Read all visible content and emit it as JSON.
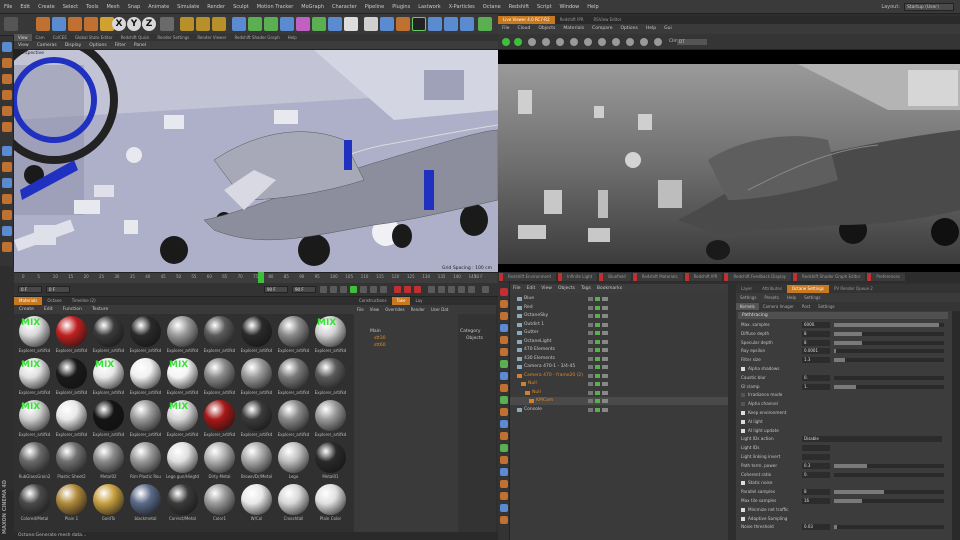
{
  "menubar": {
    "items": [
      "File",
      "Edit",
      "Create",
      "Select",
      "Tools",
      "Mesh",
      "Snap",
      "Animate",
      "Simulate",
      "Render",
      "Sculpt",
      "Motion Tracker",
      "MoGraph",
      "Character",
      "Pipeline",
      "Plugins",
      "Lastwork",
      "X-Particles",
      "Octane",
      "Redshift",
      "Script",
      "Window",
      "Help"
    ],
    "layout_label": "Layout:",
    "layout_value": "Startup (User)"
  },
  "toolbar": {
    "x": "X",
    "y": "Y",
    "z": "Z"
  },
  "viewport": {
    "tabs": [
      "View",
      "Cam",
      "ColCEE",
      "Global State Editor",
      "Redshift Quick",
      "Render Settings",
      "Render Viewer",
      "Redshift Shader Graph",
      "Help"
    ],
    "menu": [
      "View",
      "Cameras",
      "Display",
      "Options",
      "Filter",
      "Panel"
    ],
    "label": "Perspective",
    "grid_spacing": "Grid Spacing : 100 cm"
  },
  "renderview": {
    "tabs": [
      "Live Viewer 4.0 RC7-R2",
      "Redshift IPR",
      "RSView Editor"
    ],
    "menu": [
      "File",
      "Cloud",
      "Objects",
      "Materials",
      "Compare",
      "Options",
      "Help",
      "Gui"
    ],
    "clm_label": "Clm:",
    "dropdown": "DT"
  },
  "timeline": {
    "ticks": [
      "0",
      "5",
      "10",
      "15",
      "20",
      "25",
      "30",
      "35",
      "40",
      "45",
      "50",
      "55",
      "60",
      "65",
      "70",
      "75",
      "80",
      "85",
      "90",
      "95",
      "100",
      "105",
      "110",
      "115",
      "120",
      "125",
      "130",
      "135",
      "140",
      "145"
    ],
    "end_label": "30 F"
  },
  "transport": {
    "field1": "0 F",
    "field2": "0 F",
    "field3": "90 F",
    "field4": "90 F"
  },
  "materials": {
    "tabs": [
      "Materials",
      "Octane",
      "Timeline (2)"
    ],
    "menu": [
      "Create",
      "Edit",
      "Function",
      "Texture"
    ],
    "items": [
      {
        "label": "Explorer_artifkd",
        "mix": true
      },
      {
        "label": "Explorer_artifkd",
        "mix": false
      },
      {
        "label": "Explorer_artifkd",
        "mix": false
      },
      {
        "label": "Explorer_artifkd",
        "mix": false
      },
      {
        "label": "Explorer_artifkd",
        "mix": false
      },
      {
        "label": "Explorer_artifkd",
        "mix": false
      },
      {
        "label": "Explorer_artifkd",
        "mix": false
      },
      {
        "label": "Explorer_artifkd",
        "mix": false
      },
      {
        "label": "Explorer_artifkd",
        "mix": true
      },
      {
        "label": "Explorer_artifkd",
        "mix": true
      },
      {
        "label": "Explorer_artifkd",
        "mix": false
      },
      {
        "label": "Explorer_artifkd",
        "mix": true
      },
      {
        "label": "Explorer_artifkd",
        "mix": false
      },
      {
        "label": "Explorer_artifkd",
        "mix": true
      },
      {
        "label": "Explorer_artifkd",
        "mix": false
      },
      {
        "label": "Explorer_artifkd",
        "mix": false
      },
      {
        "label": "Explorer_artifkd",
        "mix": false
      },
      {
        "label": "Explorer_artifkd",
        "mix": false
      },
      {
        "label": "Explorer_artifkd",
        "mix": true
      },
      {
        "label": "Explorer_artifkd",
        "mix": false
      },
      {
        "label": "Explorer_artifkd",
        "mix": false
      },
      {
        "label": "Explorer_artifkd",
        "mix": false
      },
      {
        "label": "Explorer_artifkd",
        "mix": true
      },
      {
        "label": "Explorer_artifkd",
        "mix": false
      },
      {
        "label": "Explorer_artifkd",
        "mix": false
      },
      {
        "label": "Explorer_artifkd",
        "mix": false
      },
      {
        "label": "Explorer_artifkd",
        "mix": false
      },
      {
        "label": "RubGlassGroin2",
        "mix": false
      },
      {
        "label": "Plastic Sheet2",
        "mix": false
      },
      {
        "label": "Metal02",
        "mix": false
      },
      {
        "label": "Rim Plastic Rou",
        "mix": false
      },
      {
        "label": "Lego gun/Hiegtd",
        "mix": false
      },
      {
        "label": "Dirty Metal",
        "mix": false
      },
      {
        "label": "Brown/Dr/Metal",
        "mix": false
      },
      {
        "label": "Lego",
        "mix": false
      },
      {
        "label": "Metal01",
        "mix": false
      },
      {
        "label": "Colored/Metal",
        "mix": false
      },
      {
        "label": "Plain 1",
        "mix": false
      },
      {
        "label": "GoldTo",
        "mix": false
      },
      {
        "label": "blackmetal",
        "mix": false
      },
      {
        "label": "Correct/Metal",
        "mix": false
      },
      {
        "label": "Color1",
        "mix": false
      },
      {
        "label": "W/Col",
        "mix": false
      },
      {
        "label": "Crosshtall",
        "mix": false
      },
      {
        "label": "Plain Color",
        "mix": false
      }
    ]
  },
  "layers": {
    "tabs": [
      "Constructions",
      "Take",
      "Lay"
    ],
    "menu": [
      "File",
      "View",
      "Overrides",
      "Render",
      "User Dat"
    ],
    "rows": [
      "Main",
      "stt30",
      "stt60"
    ],
    "category_label": "Category",
    "category_item": "Objects"
  },
  "object_manager": {
    "tabs": [
      "Redshift Environment",
      "Infinite Light",
      "Bluefield",
      "Redshift Materials",
      "Redshift IPR",
      "Redshift Feedback Display",
      "Redshift Shader Graph Editor",
      "Preferences"
    ],
    "menu": [
      "File",
      "Edit",
      "View",
      "Objects",
      "Tags",
      "Bookmarks"
    ],
    "rows": [
      "Blue",
      "Red",
      "OctaneSky",
      "Outdirt 1",
      "Gutter",
      "OctaneLight",
      "470 Elements",
      "430 Elements",
      "Camera 470-1 - 3/4-45",
      "Camera 470 - frame20 (2)",
      "Null",
      "Null",
      "KMCam",
      "Console"
    ]
  },
  "attributes": {
    "tabs": [
      "Layer",
      "Attributes",
      "Octane Settings",
      "PV Render Queue 2"
    ],
    "sub": [
      "Settings",
      "Presets",
      "Help",
      "Settings"
    ],
    "sub2": [
      "Kernels",
      "Camera Imager",
      "Post",
      "Settings"
    ],
    "section": "Pathtracing",
    "rows": [
      {
        "label": "Max. samples",
        "value": "6000.",
        "fill": 0.95
      },
      {
        "label": "Diffuse depth",
        "value": "8",
        "fill": 0.25
      },
      {
        "label": "Specular depth",
        "value": "8",
        "fill": 0.25
      },
      {
        "label": "Ray epsilon",
        "value": "0.0001",
        "fill": 0.02
      },
      {
        "label": "Filter size",
        "value": "1.3",
        "fill": 0.1
      },
      {
        "label": "Alpha shadows",
        "check": true
      },
      {
        "label": "Caustic blur",
        "value": "0.",
        "fill": 0.0
      },
      {
        "label": "GI clamp",
        "value": "1.",
        "fill": 0.2
      },
      {
        "label": "Irradiance mode",
        "check": false
      },
      {
        "label": "Alpha channel",
        "check": false
      },
      {
        "label": "Keep environment",
        "check": true
      },
      {
        "label": "AI light",
        "check": true
      },
      {
        "label": "AI light update",
        "check": true
      },
      {
        "label": "Light IDs action",
        "value": "Disable",
        "fill": 0
      },
      {
        "label": "Light IDs",
        "value": "",
        "fill": 0
      },
      {
        "label": "Light linking invert",
        "value": "",
        "fill": 0
      },
      {
        "label": "Path term. power",
        "value": "0.3",
        "fill": 0.3
      },
      {
        "label": "Coherent ratio",
        "value": "0.",
        "fill": 0.0
      },
      {
        "label": "Static noise",
        "check": true
      },
      {
        "label": "Parallel samples",
        "value": "8",
        "fill": 0.45
      },
      {
        "label": "Max tile samples",
        "value": "16",
        "fill": 0.25
      },
      {
        "label": "Minimize net traffic",
        "check": true
      },
      {
        "label": "Adaptive Sampling",
        "check": true
      },
      {
        "label": "Noise threshold",
        "value": "0.03",
        "fill": 0.03
      }
    ]
  },
  "status": {
    "text": "Octane:Generate mesh data..."
  },
  "maxon": {
    "text": "MAXON CINEMA 4D"
  }
}
